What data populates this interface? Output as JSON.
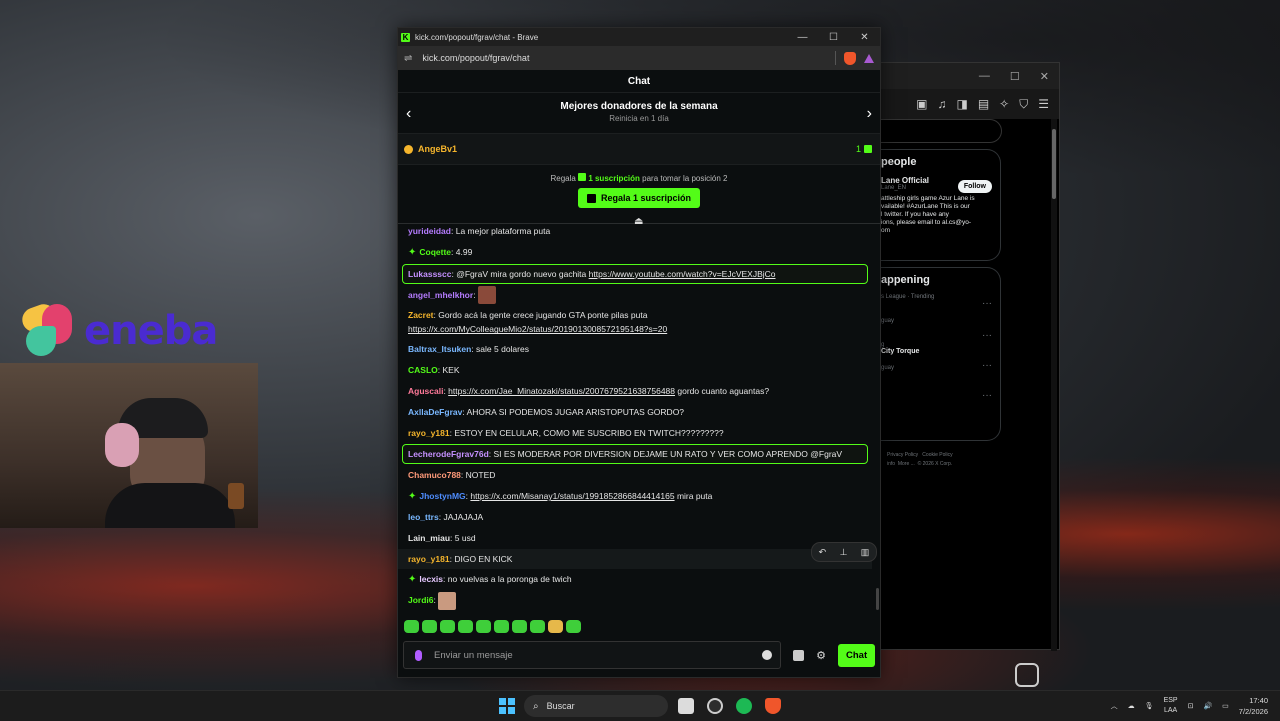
{
  "browser": {
    "title": "kick.com/popout/fgrav/chat - Brave",
    "url": "kick.com/popout/fgrav/chat",
    "kick_logo": "K"
  },
  "chat": {
    "header": "Chat",
    "leaderboard_title": "Mejores donadores de la semana",
    "leaderboard_sub": "Reinicia en 1 día",
    "top_donor": "AngeBv1",
    "top_donor_count": "1",
    "gift_prefix": "Regala",
    "gift_amount": "1 suscripción",
    "gift_suffix": "para tomar la posición 2",
    "gift_button": "Regala 1 suscripción",
    "input_placeholder": "Enviar un mensaje",
    "send_button": "Chat"
  },
  "messages": [
    {
      "user": "yurideidad",
      "color": "#b57cff",
      "text": "La mejor plataforma puta"
    },
    {
      "user": "Coqette",
      "color": "#53fc18",
      "text": "4.99",
      "badge": "sparkle"
    },
    {
      "user": "Lukassscc",
      "color": "#c591ff",
      "text": "@FgraV mira gordo nuevo gachita",
      "link": "https://www.youtube.com/watch?v=EJcVEXJBjCo",
      "highlight": true
    },
    {
      "user": "angel_mhelkhor",
      "color": "#b57cff",
      "text": "",
      "emote": "emote-image"
    },
    {
      "user": "Zacret",
      "color": "#f5b52c",
      "text": "Gordo acá la gente crece jugando GTA ponte pilas puta",
      "link": "https://x.com/MyColleagueMio2/status/2019013008572195148?s=20",
      "two_line": true
    },
    {
      "user": "Baltrax_Itsuken",
      "color": "#7ab8ff",
      "text": "sale 5 dolares"
    },
    {
      "user": "CASLO",
      "color": "#53fc18",
      "text": "KEK"
    },
    {
      "user": "Aguscali",
      "color": "#ff7a9a",
      "link": "https://x.com/Jae_Minatozaki/status/2007679521638756488",
      "text_after": "gordo cuanto aguantas?"
    },
    {
      "user": "AxllaDeFgrav",
      "color": "#7ab8ff",
      "text": "AHORA SI PODEMOS JUGAR ARISTOPUTAS GORDO?"
    },
    {
      "user": "rayo_y181",
      "color": "#f5b52c",
      "text": "ESTOY EN CELULAR, COMO ME SUSCRIBO EN TWITCH?????????"
    },
    {
      "user": "LecherodeFgrav76d",
      "color": "#c591ff",
      "text": "SI ES MODERAR POR DIVERSION DEJAME UN RATO Y VER COMO APRENDO @FgraV",
      "highlight": true
    },
    {
      "user": "Chamuco788",
      "color": "#ff9a7a",
      "text": "NOTED"
    },
    {
      "user": "JhostynMG",
      "color": "#4e8dff",
      "link": "https://x.com/Misanay1/status/1991852866844414165",
      "text_after": "mira puta",
      "badge": "sparkle"
    },
    {
      "user": "leo_ttrs",
      "color": "#7ab8ff",
      "text": "JAJAJAJA"
    },
    {
      "user": "Lain_miau",
      "color": "#e6e6e6",
      "text": "5 usd"
    },
    {
      "user": "rayo_y181",
      "color": "#f5b52c",
      "text": "DIGO EN KICK",
      "hover": true
    },
    {
      "user": "lecxis",
      "color": "#e6c8ff",
      "text": "no vuelvas a la poronga de twich",
      "badge": "sparkle"
    },
    {
      "user": "Jordi6",
      "color": "#53fc18",
      "text": "",
      "emote": "emote-image"
    }
  ],
  "overlay": {
    "brand": "eneba"
  },
  "twitter": {
    "section1": "people",
    "account_name": "Lane Official",
    "account_handle": "Lane_EN",
    "follow": "Follow",
    "bio_lines": [
      "attleship girls game Azur Lane is",
      "vailable! #AzurLane This is our",
      "l twitter. If you have any",
      "ions, please email to al.cs@yo-",
      "om"
    ],
    "section2": "appening",
    "trend_meta": [
      "s League · Trending",
      "guay",
      "g",
      "guay"
    ],
    "trend3": "City Torque",
    "footer": [
      "Privacy Policy",
      "Cookie Policy",
      "info",
      "More ...",
      "© 2026 X Corp."
    ]
  },
  "taskbar": {
    "search": "Buscar",
    "lang_top": "ESP",
    "lang_bottom": "LAA",
    "time": "17:40",
    "date": "7/2/2026"
  }
}
